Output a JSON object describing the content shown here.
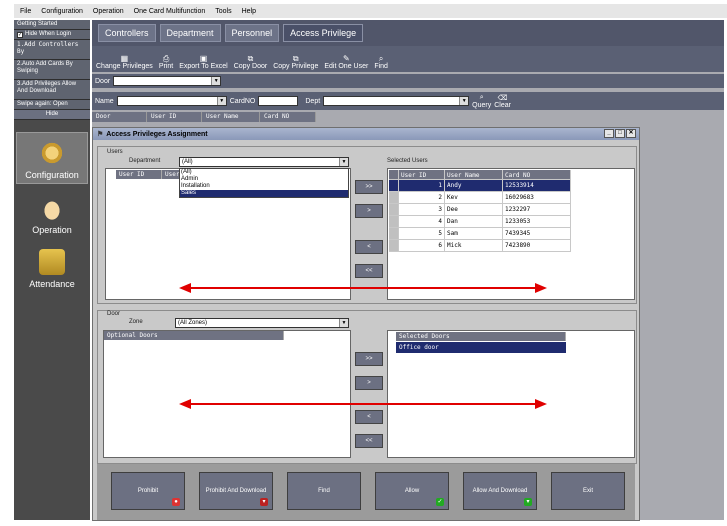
{
  "menubar": [
    "File",
    "Configuration",
    "Operation",
    "One Card Multifunction",
    "Tools",
    "Help"
  ],
  "leftpanel": {
    "getting_started": "Getting Started",
    "hide_when_login": "Hide When Login",
    "step1": "1.Add Controllers By",
    "step2": "2.Auto Add Cards By Swiping",
    "step3": "3.Add Privileges Allow And Download",
    "step4": "Swipe again: Open",
    "hide": "Hide",
    "nav": [
      "Configuration",
      "Operation",
      "Attendance"
    ]
  },
  "tabs": [
    "Controllers",
    "Department",
    "Personnel",
    "Access Privilege"
  ],
  "toolbar": [
    {
      "label": "Change Privileges",
      "icon": "grid-icon"
    },
    {
      "label": "Print",
      "icon": "printer-icon"
    },
    {
      "label": "Export To Excel",
      "icon": "export-icon"
    },
    {
      "label": "Copy Door",
      "icon": "copy-icon"
    },
    {
      "label": "Copy Privilege",
      "icon": "copy-icon"
    },
    {
      "label": "Edit One User",
      "icon": "pen-icon"
    },
    {
      "label": "Find",
      "icon": "search-icon"
    }
  ],
  "doorrow": {
    "label": "Door"
  },
  "filterrow": {
    "name_label": "Name",
    "cardno_label": "CardNO",
    "dept_label": "Dept",
    "query": "Query",
    "clear": "Clear"
  },
  "bg_headers": [
    "Door",
    "User ID",
    "User Name",
    "Card NO"
  ],
  "dialog": {
    "title": "Access Privileges Assignment",
    "users_group": "Users",
    "department_label": "Department",
    "department_value": "(All)",
    "department_options": [
      "(All)",
      "Admin",
      "Installation",
      "Sales"
    ],
    "department_selected": "Sales",
    "left_headers": [
      "User ID",
      "User"
    ],
    "selected_users_label": "Selected Users",
    "user_headers": [
      "User ID",
      "User Name",
      "Card NO"
    ],
    "users": [
      {
        "id": "1",
        "name": "Andy",
        "card": "12533914"
      },
      {
        "id": "2",
        "name": "Kev",
        "card": "16029683"
      },
      {
        "id": "3",
        "name": "Dee",
        "card": "1232297"
      },
      {
        "id": "4",
        "name": "Dan",
        "card": "1233053"
      },
      {
        "id": "5",
        "name": "Sam",
        "card": "7439345"
      },
      {
        "id": "6",
        "name": "Mick",
        "card": "7423890"
      }
    ],
    "door_group": "Door",
    "zone_label": "Zone",
    "zone_value": "(All Zones)",
    "optional_doors_header": "Optional Doors",
    "selected_doors_header": "Selected Doors",
    "selected_doors": [
      "Office door"
    ],
    "move_buttons": [
      ">>",
      ">",
      "<",
      "<<"
    ],
    "bottom_buttons": [
      "Prohibit",
      "Prohibit And Download",
      "Find",
      "Allow",
      "Allow And Download",
      "Exit"
    ]
  },
  "colors": {
    "accent": "#1f2b6f",
    "arrow": "#e00000",
    "panel": "#6c7082"
  }
}
